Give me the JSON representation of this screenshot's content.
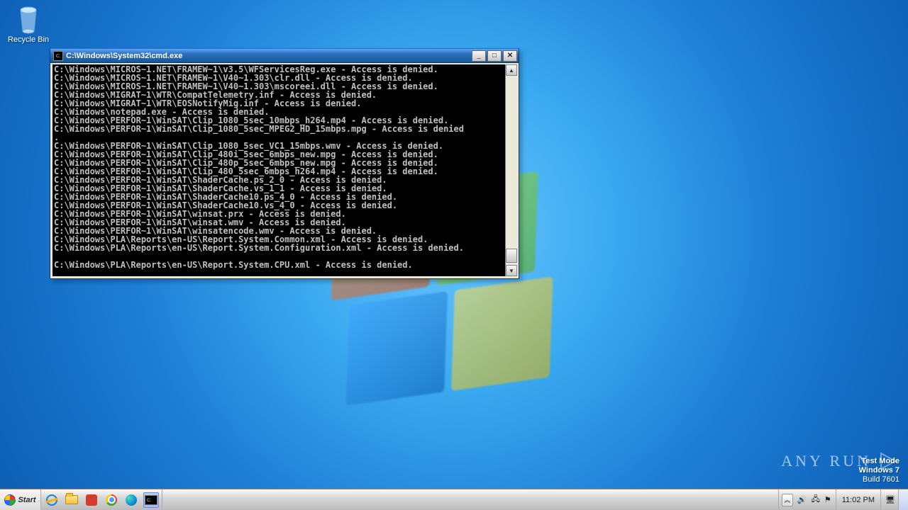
{
  "desktop": {
    "recycle_bin_label": "Recycle Bin"
  },
  "window": {
    "title": "C:\\Windows\\System32\\cmd.exe",
    "lines": [
      "C:\\Windows\\MICROS~1.NET\\FRAMEW~1\\v3.5\\WFServicesReg.exe - Access is denied.",
      "C:\\Windows\\MICROS~1.NET\\FRAMEW~1\\V40~1.303\\clr.dll - Access is denied.",
      "C:\\Windows\\MICROS~1.NET\\FRAMEW~1\\V40~1.303\\mscoreei.dll - Access is denied.",
      "C:\\Windows\\MIGRAT~1\\WTR\\CompatTelemetry.inf - Access is denied.",
      "C:\\Windows\\MIGRAT~1\\WTR\\EOSNotifyMig.inf - Access is denied.",
      "C:\\Windows\\notepad.exe - Access is denied.",
      "C:\\Windows\\PERFOR~1\\WinSAT\\Clip_1080_5sec_10mbps_h264.mp4 - Access is denied.",
      "C:\\Windows\\PERFOR~1\\WinSAT\\Clip_1080_5sec_MPEG2_HD_15mbps.mpg - Access is denied",
      ".",
      "C:\\Windows\\PERFOR~1\\WinSAT\\Clip_1080_5sec_VC1_15mbps.wmv - Access is denied.",
      "C:\\Windows\\PERFOR~1\\WinSAT\\Clip_480i_5sec_6mbps_new.mpg - Access is denied.",
      "C:\\Windows\\PERFOR~1\\WinSAT\\Clip_480p_5sec_6mbps_new.mpg - Access is denied.",
      "C:\\Windows\\PERFOR~1\\WinSAT\\Clip_480_5sec_6mbps_h264.mp4 - Access is denied.",
      "C:\\Windows\\PERFOR~1\\WinSAT\\ShaderCache.ps_2_0 - Access is denied.",
      "C:\\Windows\\PERFOR~1\\WinSAT\\ShaderCache.vs_1_1 - Access is denied.",
      "C:\\Windows\\PERFOR~1\\WinSAT\\ShaderCache10.ps_4_0 - Access is denied.",
      "C:\\Windows\\PERFOR~1\\WinSAT\\ShaderCache10.vs_4_0 - Access is denied.",
      "C:\\Windows\\PERFOR~1\\WinSAT\\winsat.prx - Access is denied.",
      "C:\\Windows\\PERFOR~1\\WinSAT\\winsat.wmv - Access is denied.",
      "C:\\Windows\\PERFOR~1\\WinSAT\\winsatencode.wmv - Access is denied.",
      "C:\\Windows\\PLA\\Reports\\en-US\\Report.System.Common.xml - Access is denied.",
      "C:\\Windows\\PLA\\Reports\\en-US\\Report.System.Configuration.xml - Access is denied.",
      "",
      "C:\\Windows\\PLA\\Reports\\en-US\\Report.System.CPU.xml - Access is denied."
    ]
  },
  "watermark": {
    "brand": "ANY   RUN",
    "line1": "Test Mode",
    "line2": "Windows 7",
    "line3": "Build 7601"
  },
  "taskbar": {
    "start_label": "Start",
    "clock": "11:02 PM"
  }
}
